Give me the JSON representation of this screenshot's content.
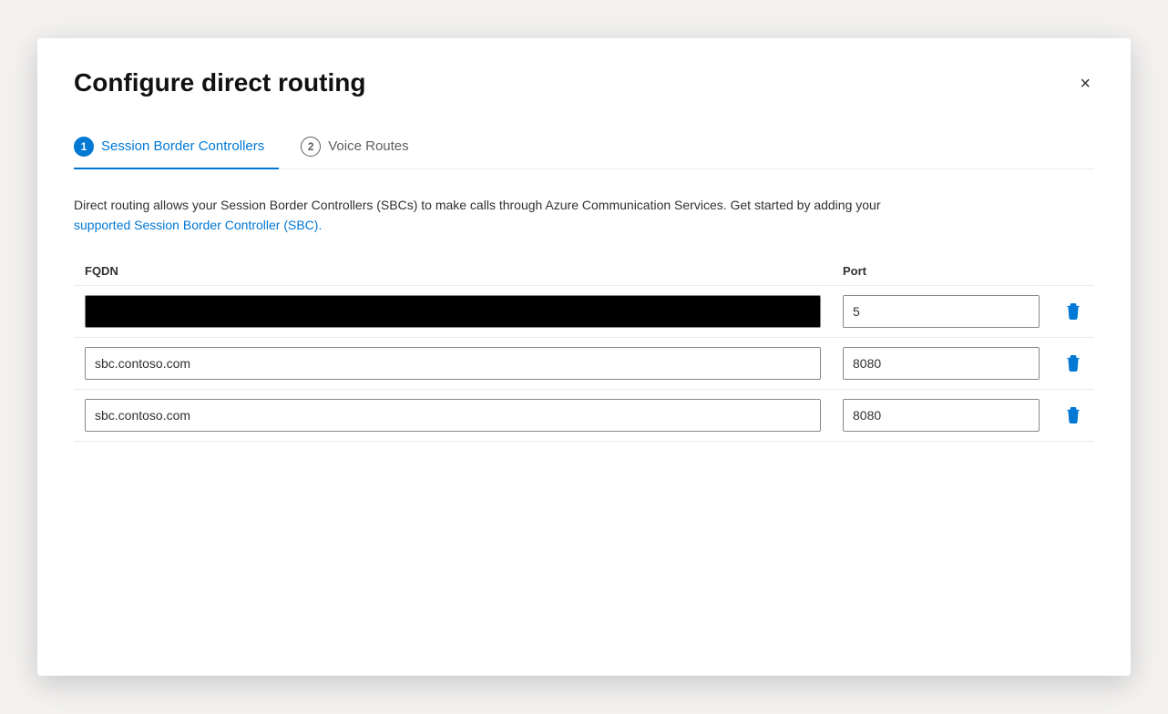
{
  "dialog": {
    "title": "Configure direct routing",
    "close_label": "×"
  },
  "tabs": [
    {
      "id": "sbc",
      "number": "1",
      "label": "Session Border Controllers",
      "active": true
    },
    {
      "id": "voice",
      "number": "2",
      "label": "Voice Routes",
      "active": false
    }
  ],
  "description": {
    "text_before_link": "Direct routing allows your Session Border Controllers (SBCs) to make calls through Azure Communication Services. Get started by adding your ",
    "link_text": "supported Session Border Controller (SBC).",
    "link_href": "#"
  },
  "table": {
    "columns": [
      {
        "id": "fqdn",
        "label": "FQDN"
      },
      {
        "id": "port",
        "label": "Port"
      }
    ],
    "rows": [
      {
        "id": "row1",
        "fqdn_value": "",
        "fqdn_placeholder": "",
        "fqdn_redacted": true,
        "port_value": "5",
        "port_placeholder": ""
      },
      {
        "id": "row2",
        "fqdn_value": "sbc.contoso.com",
        "fqdn_placeholder": "",
        "fqdn_redacted": false,
        "port_value": "8080",
        "port_placeholder": ""
      },
      {
        "id": "row3",
        "fqdn_value": "sbc.contoso.com",
        "fqdn_placeholder": "",
        "fqdn_redacted": false,
        "port_value": "8080",
        "port_placeholder": ""
      }
    ]
  }
}
